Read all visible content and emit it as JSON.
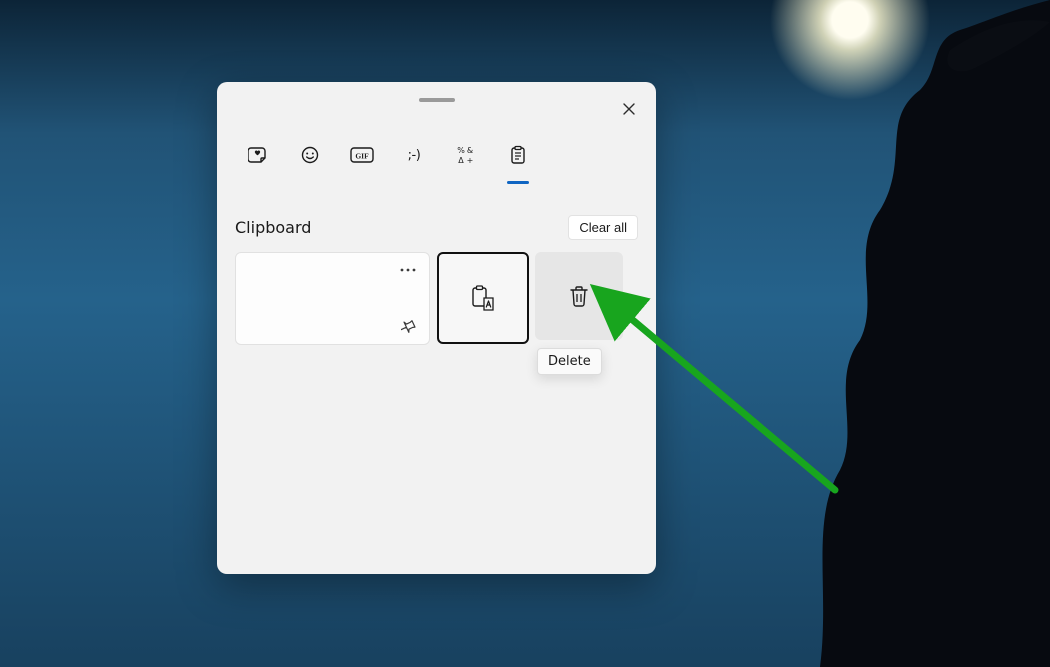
{
  "header": {
    "title": "Clipboard",
    "clear_label": "Clear all"
  },
  "tabs": [
    {
      "name": "recent",
      "icon": "sticker-heart-icon",
      "active": false
    },
    {
      "name": "emoji",
      "icon": "smiley-icon",
      "active": false
    },
    {
      "name": "gif",
      "icon": "gif-icon",
      "active": false
    },
    {
      "name": "kaomoji",
      "icon": "kaomoji-icon",
      "active": false
    },
    {
      "name": "symbols",
      "icon": "symbols-icon",
      "active": false
    },
    {
      "name": "clipboard",
      "icon": "clipboard-icon",
      "active": true
    }
  ],
  "clipboard": {
    "item": {
      "content": "",
      "more_tooltip": "See more",
      "pin_tooltip": "Pin"
    },
    "actions": {
      "paste_as_text": {
        "tooltip": "Paste as text",
        "selected": true
      },
      "delete": {
        "tooltip": "Delete",
        "hovered": true
      }
    }
  },
  "tooltip_shown": "Delete",
  "annotation": {
    "arrow_color": "#18a51e"
  }
}
